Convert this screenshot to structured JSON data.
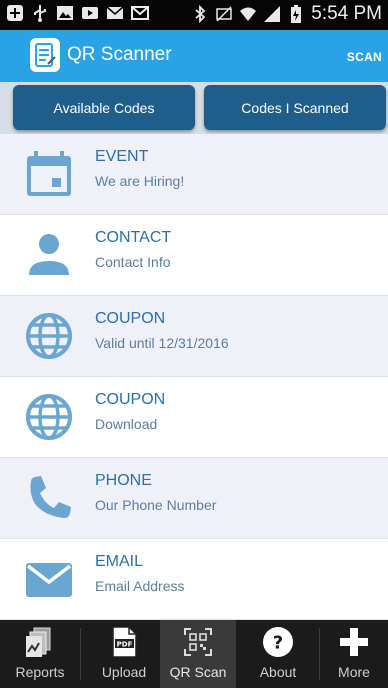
{
  "status_bar": {
    "time": "5:54 PM",
    "icons_left": [
      "add-box-icon",
      "usb-icon",
      "gallery-icon",
      "video-icon",
      "email-notification-icon",
      "gmail-icon"
    ],
    "icons_right": [
      "bluetooth-icon",
      "mute-icon",
      "wifi-icon",
      "signal-icon",
      "battery-icon"
    ]
  },
  "app_bar": {
    "title": "QR Scanner",
    "action_label": "SCAN",
    "color": "#2aa3e6"
  },
  "tabs": [
    {
      "label": "Available Codes"
    },
    {
      "label": "Codes I Scanned"
    }
  ],
  "list": {
    "items": [
      {
        "type": "EVENT",
        "description": "We are Hiring!",
        "icon": "calendar-icon"
      },
      {
        "type": "CONTACT",
        "description": "Contact Info",
        "icon": "person-icon"
      },
      {
        "type": "COUPON",
        "description": "Valid until 12/31/2016",
        "icon": "globe-icon"
      },
      {
        "type": "COUPON",
        "description": "Download",
        "icon": "globe-icon"
      },
      {
        "type": "PHONE",
        "description": "Our Phone Number",
        "icon": "phone-icon"
      },
      {
        "type": "EMAIL",
        "description": "Email Address",
        "icon": "envelope-icon"
      }
    ]
  },
  "bottom_nav": {
    "items": [
      {
        "label": "Reports",
        "icon": "reports-icon"
      },
      {
        "label": "Upload",
        "icon": "pdf-icon"
      },
      {
        "label": "QR Scan",
        "icon": "qr-code-icon",
        "active": true
      },
      {
        "label": "About",
        "icon": "help-icon"
      },
      {
        "label": "More",
        "icon": "plus-icon"
      }
    ]
  },
  "colors": {
    "accent": "#2aa3e6",
    "tab": "#1f5e8b",
    "icon": "#6aa6cf",
    "item_title": "#2c6fa3",
    "item_shaded_bg": "#f0f0f9"
  }
}
